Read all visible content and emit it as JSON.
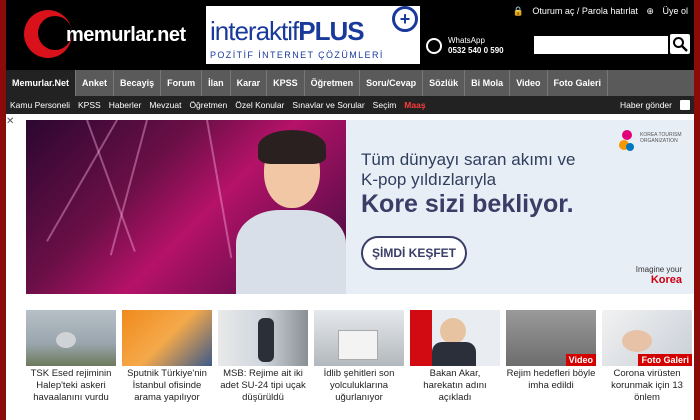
{
  "header": {
    "logo_text": "memurlar.net",
    "ad": {
      "title_light": "interaktif",
      "title_bold": "PLUS",
      "subtitle": "POZİTİF İNTERNET ÇÖZÜMLERİ"
    },
    "whatsapp": {
      "label": "WhatsApp",
      "phone": "0532 540 0 590"
    },
    "login_text": "Oturum aç / Parola hatırlat",
    "register_text": "Üye ol",
    "search": {
      "placeholder": ""
    }
  },
  "nav": {
    "items": [
      "Memurlar.Net",
      "Anket",
      "Becayiş",
      "Forum",
      "İlan",
      "Karar",
      "KPSS",
      "Öğretmen",
      "Soru/Cevap",
      "Sözlük",
      "Bi Mola",
      "Video",
      "Foto Galeri"
    ]
  },
  "subnav": {
    "items": [
      "Kamu Personeli",
      "KPSS",
      "Haberler",
      "Mevzuat",
      "Öğretmen",
      "Özel Konular",
      "Sınavlar ve Sorular",
      "Seçim",
      "Maaş"
    ],
    "send_news": "Haber gönder"
  },
  "advert": {
    "line1": "Tüm dünyayı saran akımı ve",
    "line2": "K-pop yıldızlarıyla",
    "line3": "Kore sizi bekliyor.",
    "cta": "ŞİMDİ KEŞFET",
    "org": "KOREA TOURISM ORGANIZATION",
    "imagine_small": "Imagine your",
    "imagine_big": "Korea"
  },
  "news": [
    {
      "caption": "TSK Esed rejiminin Halep'teki askeri havaalanını vurdu",
      "tag": ""
    },
    {
      "caption": "Sputnik Türkiye'nin İstanbul ofisinde arama yapılıyor",
      "tag": ""
    },
    {
      "caption": "MSB: Rejime ait iki adet SU-24 tipi uçak düşürüldü",
      "tag": ""
    },
    {
      "caption": "İdlib şehitleri son yolculuklarına uğurlanıyor",
      "tag": ""
    },
    {
      "caption": "Bakan Akar, harekatın adını açıkladı",
      "tag": ""
    },
    {
      "caption": "Rejim hedefleri böyle imha edildi",
      "tag": "Video"
    },
    {
      "caption": "Corona virüsten korunmak için 13 önlem",
      "tag": "Foto Galeri"
    }
  ],
  "colors": {
    "brand_red": "#d8111a",
    "nav_bg": "#5a5a5a",
    "frame_red": "#8b0a0a"
  }
}
